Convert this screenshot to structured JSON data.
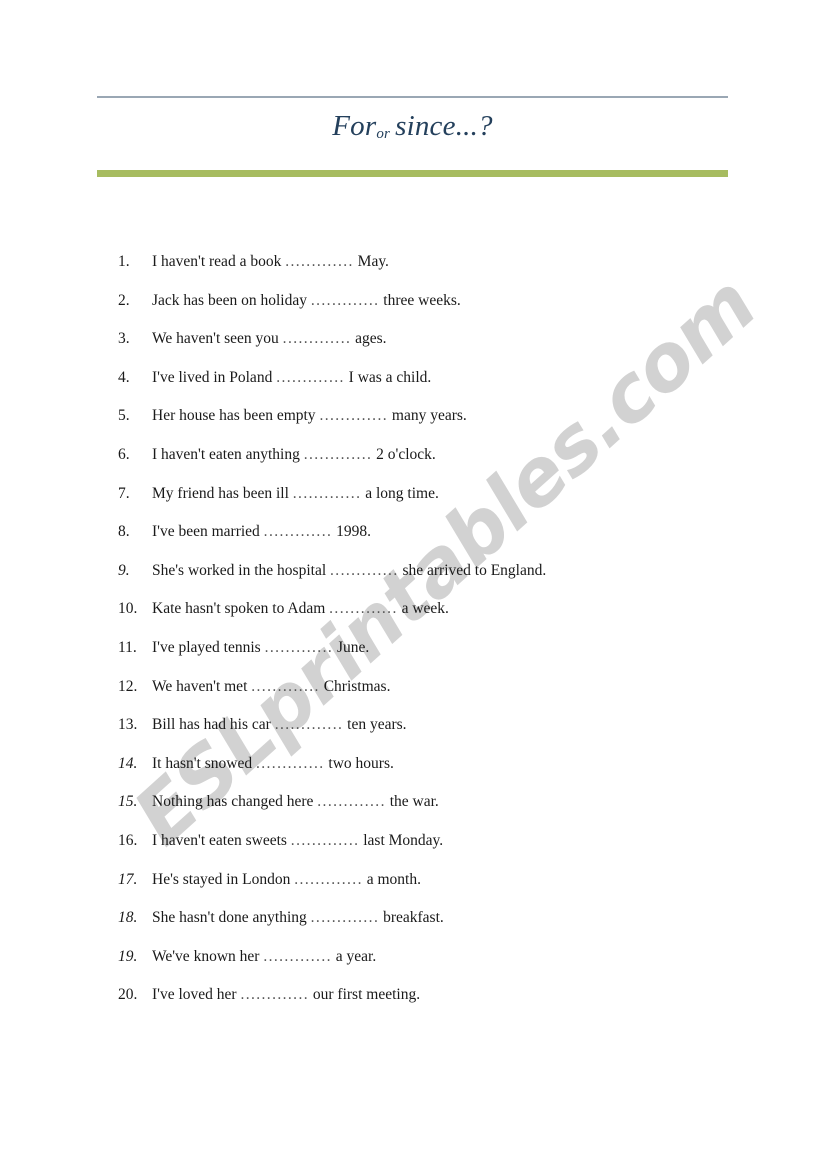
{
  "worksheet": {
    "title": {
      "part1": "For",
      "part2": "or",
      "part3": "since...?"
    },
    "accent_color_green": "#a7bc60",
    "accent_color_rule": "#9aa7b4",
    "title_color": "#24405c",
    "watermark": "ESLprintables.com",
    "gap": ".............",
    "items": [
      {
        "num": "1.",
        "num_italic": false,
        "before": "I haven't read a book",
        "after": "May."
      },
      {
        "num": "2.",
        "num_italic": false,
        "before": "Jack has been on holiday",
        "after": "three weeks."
      },
      {
        "num": "3.",
        "num_italic": false,
        "before": "We haven't seen you",
        "after": "ages."
      },
      {
        "num": "4.",
        "num_italic": false,
        "before": "I've lived in Poland",
        "after": "I was a child."
      },
      {
        "num": "5.",
        "num_italic": false,
        "before": "Her house has been empty",
        "after": "many years."
      },
      {
        "num": "6.",
        "num_italic": false,
        "before": "I haven't eaten anything",
        "after": "2 o'clock."
      },
      {
        "num": "7.",
        "num_italic": false,
        "before": "My friend has been ill",
        "after": "a long time."
      },
      {
        "num": "8.",
        "num_italic": false,
        "before": "I've been married",
        "after": "1998."
      },
      {
        "num": "9.",
        "num_italic": true,
        "before": "She's worked in the hospital",
        "after": "she arrived to England."
      },
      {
        "num": "10.",
        "num_italic": false,
        "before": "Kate hasn't spoken to Adam",
        "after": "a week."
      },
      {
        "num": "11.",
        "num_italic": false,
        "before": "I've played tennis",
        "after": "June."
      },
      {
        "num": "12.",
        "num_italic": false,
        "before": "We haven't met",
        "after": "Christmas."
      },
      {
        "num": "13.",
        "num_italic": false,
        "before": "Bill has had his car",
        "after": "ten years."
      },
      {
        "num": "14.",
        "num_italic": true,
        "before": "It hasn't snowed",
        "after": "two hours."
      },
      {
        "num": "15.",
        "num_italic": true,
        "before": "Nothing has changed here",
        "after": "the war."
      },
      {
        "num": "16.",
        "num_italic": false,
        "before": "I haven't eaten sweets",
        "after": "last Monday."
      },
      {
        "num": "17.",
        "num_italic": true,
        "before": "He's stayed in London",
        "after": "a month."
      },
      {
        "num": "18.",
        "num_italic": true,
        "before": "She hasn't done anything",
        "after": "breakfast."
      },
      {
        "num": "19.",
        "num_italic": true,
        "before": "We've known her",
        "after": "a year."
      },
      {
        "num": "20.",
        "num_italic": false,
        "before": "I've loved her",
        "after": "our first meeting."
      }
    ]
  }
}
